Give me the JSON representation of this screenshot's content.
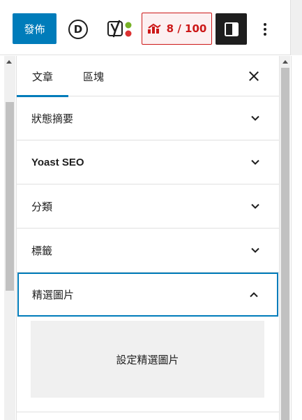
{
  "toolbar": {
    "publish_label": "發佈",
    "divi_letter": "D",
    "score_label": "8 / 100",
    "colors": {
      "publish": "#007cba",
      "score": "#cc1818",
      "yoast_green": "#77b227",
      "yoast_red": "#dc3232"
    }
  },
  "panel": {
    "tabs": [
      {
        "label": "文章",
        "active": true
      },
      {
        "label": "區塊",
        "active": false
      }
    ],
    "sections": [
      {
        "label": "狀態摘要",
        "expanded": false
      },
      {
        "label": "Yoast SEO",
        "expanded": false
      },
      {
        "label": "分類",
        "expanded": false
      },
      {
        "label": "標籤",
        "expanded": false
      },
      {
        "label": "精選圖片",
        "expanded": true
      }
    ],
    "featured_image_button": "設定精選圖片"
  }
}
